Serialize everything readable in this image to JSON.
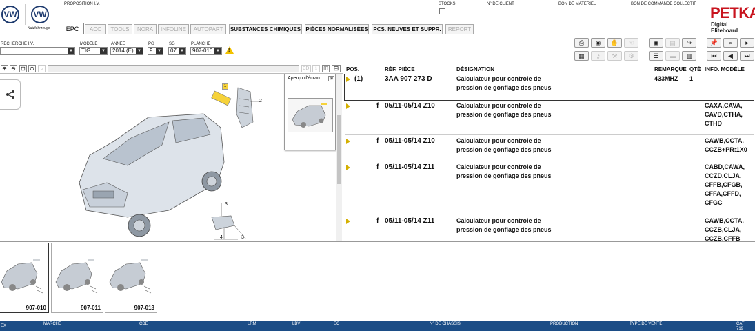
{
  "header": {
    "brand_sub": "Nutzfahrzeuge",
    "proposition": "PROPOSITION I.V.",
    "stocks": "STOCKS",
    "client": "N° DE CLIENT",
    "materiel": "BON DE MATÉRIEL",
    "commande": "BON DE COMMANDE COLLECTIF",
    "petka": "PETKA",
    "petka_sub": "Digital Eliteboard"
  },
  "tabs": [
    {
      "label": "EPC"
    },
    {
      "label": "ACC"
    },
    {
      "label": "TOOLS"
    },
    {
      "label": "NORA"
    },
    {
      "label": "INFOLINE"
    },
    {
      "label": "AUTOPART"
    },
    {
      "label": "SUBSTANCES CHIMIQUES"
    },
    {
      "label": "PIÈCES NORMALISÉES"
    },
    {
      "label": "PCS. NEUVES ET SUPPR."
    },
    {
      "label": "REPORT"
    }
  ],
  "filters": {
    "recherche_label": "RECHERCHE I.V.",
    "recherche_value": "",
    "modele_label": "MODÈLE",
    "modele_value": "TIG",
    "annee_label": "ANNÉE",
    "annee_value": "2014 (E)",
    "pg_label": "PG",
    "pg_value": "9",
    "sg_label": "SG",
    "sg_value": "07",
    "planche_label": "PLANCHE",
    "planche_value": "907-010"
  },
  "view": {
    "mode_3d": "3D",
    "preview_title": "Aperçu d'écran",
    "callouts": [
      "1",
      "2",
      "3",
      "4",
      "3"
    ]
  },
  "table": {
    "headers": {
      "pos": "POS.",
      "ref": "RÉF. PIÈCE",
      "designation": "DÉSIGNATION",
      "remarque": "REMARQUE",
      "qte": "QTÉ",
      "info": "INFO. MODÈLE"
    },
    "rows": [
      {
        "pos": "(1)",
        "ref": "3AA 907 273 D",
        "des": "Calculateur pour controle de\npression de gonflage des pneus",
        "rem": "433MHZ",
        "qte": "1",
        "info": ""
      },
      {
        "pos": "f",
        "ref": "05/11-05/14 Z10",
        "des": "Calculateur pour controle de\npression de gonflage des pneus",
        "rem": "",
        "qte": "",
        "info": "CAXA,CAVA,\nCAVD,CTHA,\nCTHD"
      },
      {
        "pos": "f",
        "ref": "05/11-05/14 Z10",
        "des": "Calculateur pour controle de\npression de gonflage des pneus",
        "rem": "",
        "qte": "",
        "info": "CAWB,CCTA,\nCCZB+PR:1X0"
      },
      {
        "pos": "f",
        "ref": "05/11-05/14 Z11",
        "des": "Calculateur pour controle de\npression de gonflage des pneus",
        "rem": "",
        "qte": "",
        "info": "CABD,CAWA,\nCCZD,CLJA,\nCFFB,CFGB,\nCFFA,CFFD,\nCFGC"
      },
      {
        "pos": "f",
        "ref": "05/11-05/14 Z11",
        "des": "Calculateur pour controle de\npression de gonflage des pneus",
        "rem": "",
        "qte": "",
        "info": "CAWB,CCTA,\nCCZB,CLJA,\nCCZB,CFFB"
      }
    ]
  },
  "thumbnails": [
    {
      "label": "907-010"
    },
    {
      "label": "907-011"
    },
    {
      "label": "907-013"
    }
  ],
  "status": {
    "ex": "EX",
    "marche": "MARCHÉ",
    "cde": "CDE",
    "lrm": "LRM",
    "lbv": "LBV",
    "ec": "EC",
    "chassis": "N° DE CHÂSSIS",
    "production": "PRODUCTION",
    "type_vente": "TYPE DE VENTE",
    "cat": "CAT",
    "cat_value": "719"
  },
  "colors": {
    "accent": "#1c4d86",
    "marker": "#d4b000",
    "warning": "#f2c200"
  }
}
